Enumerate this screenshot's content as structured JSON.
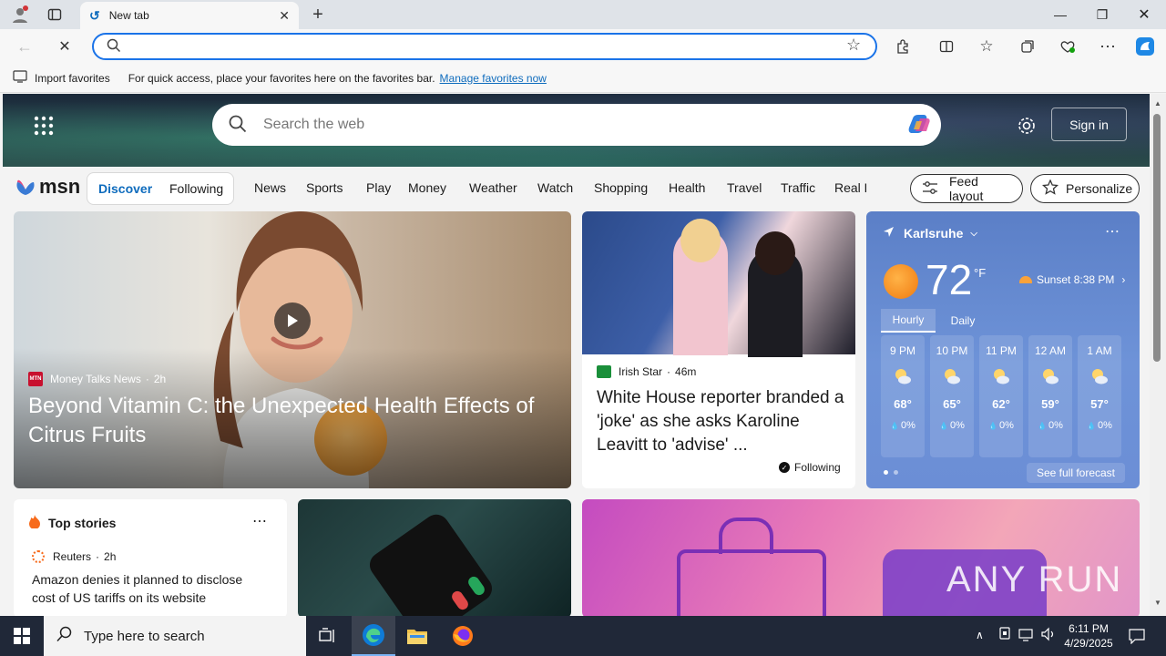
{
  "browser": {
    "tab_title": "New tab",
    "address_value": "",
    "favbar_import": "Import favorites",
    "favbar_hint": "For quick access, place your favorites here on the favorites bar.",
    "favbar_link": "Manage favorites now"
  },
  "msn": {
    "search_placeholder": "Search the web",
    "sign_in": "Sign in",
    "logo": "msn",
    "seg_discover": "Discover",
    "seg_following": "Following",
    "nav": [
      "News",
      "Sports",
      "Play",
      "Money",
      "Weather",
      "Watch",
      "Shopping",
      "Health",
      "Travel",
      "Traffic",
      "Real E"
    ],
    "feed_layout": "Feed layout",
    "personalize": "Personalize"
  },
  "hero": {
    "source_badge": "MTN",
    "source": "Money Talks News",
    "age": "2h",
    "headline": "Beyond Vitamin C: the Unexpected Health Effects of Citrus Fruits"
  },
  "story2": {
    "source": "Irish Star",
    "age": "46m",
    "headline": "White House reporter branded a 'joke' as she asks Karoline Leavitt to 'advise' ...",
    "following": "Following"
  },
  "weather": {
    "location": "Karlsruhe",
    "temp": "72",
    "unit": "°F",
    "sunset": "Sunset 8:38 PM",
    "tab_hourly": "Hourly",
    "tab_daily": "Daily",
    "hours": [
      {
        "time": "9 PM",
        "temp": "68°",
        "precip": "0%"
      },
      {
        "time": "10 PM",
        "temp": "65°",
        "precip": "0%"
      },
      {
        "time": "11 PM",
        "temp": "62°",
        "precip": "0%"
      },
      {
        "time": "12 AM",
        "temp": "59°",
        "precip": "0%"
      },
      {
        "time": "1 AM",
        "temp": "57°",
        "precip": "0%"
      }
    ],
    "see_full": "See full forecast"
  },
  "topstories": {
    "title": "Top stories",
    "source": "Reuters",
    "age": "2h",
    "headline": "Amazon denies it planned to disclose cost of US tariffs on its website"
  },
  "watermark": "ANY RUN",
  "taskbar": {
    "search_placeholder": "Type here to search",
    "time": "6:11 PM",
    "date": "4/29/2025"
  }
}
